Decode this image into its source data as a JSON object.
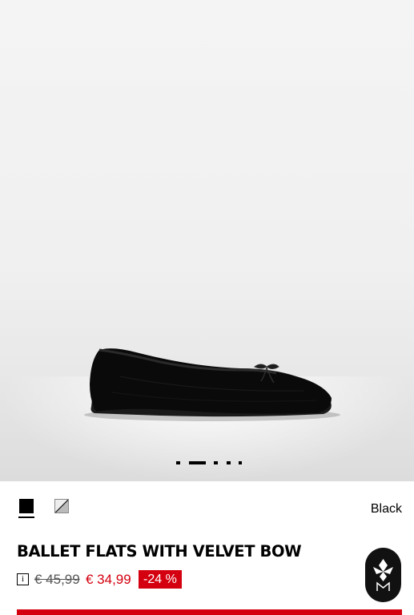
{
  "gallery": {
    "image_alt": "Black velvet ballet flat with bow",
    "slide_count": 5,
    "active_slide": 2
  },
  "colors": {
    "selected_label": "Black",
    "swatches": [
      {
        "name": "black-swatch",
        "selected": true
      },
      {
        "name": "grey-swatch",
        "selected": false
      }
    ]
  },
  "product": {
    "title": "BALLET FLATS WITH VELVET BOW",
    "info_icon_text": "i",
    "old_price": "€ 45,99",
    "new_price": "€ 34,99",
    "discount": "-24 %"
  },
  "theme": {
    "sale_red": "#d4000f",
    "text": "#000000"
  }
}
